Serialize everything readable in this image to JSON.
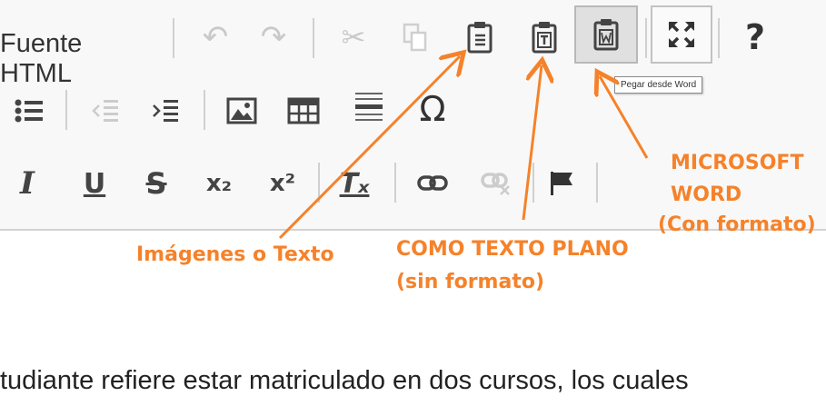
{
  "toolbar": {
    "source_label": "Fuente HTML",
    "tooltip": "Pegar desde Word",
    "glyphs": {
      "undo": "↶",
      "redo": "↷",
      "cut": "✂",
      "help": "?",
      "bullets": "☰",
      "outdent": "⇤",
      "indent": "⇥",
      "image": "▣",
      "table": "▦",
      "hline": "≡",
      "special_char": "Ω",
      "italic": "I",
      "underline": "U",
      "strike": "S",
      "subscript": "x₂",
      "superscript": "x²",
      "remove_format": "Tₓ",
      "link": "⛓",
      "unlink": "⛓",
      "anchor": "⚑"
    }
  },
  "annotations": {
    "images_or_text": "Imágenes o Texto",
    "plain_text_line1": "COMO TEXTO PLANO",
    "plain_text_line2": "(sin formato)",
    "word_line1": "MICROSOFT",
    "word_line2": "WORD",
    "word_line3": "(Con formato)",
    "color": "#f5822a"
  },
  "content": {
    "text": "tudiante refiere estar matriculado en dos cursos, los cuales"
  }
}
